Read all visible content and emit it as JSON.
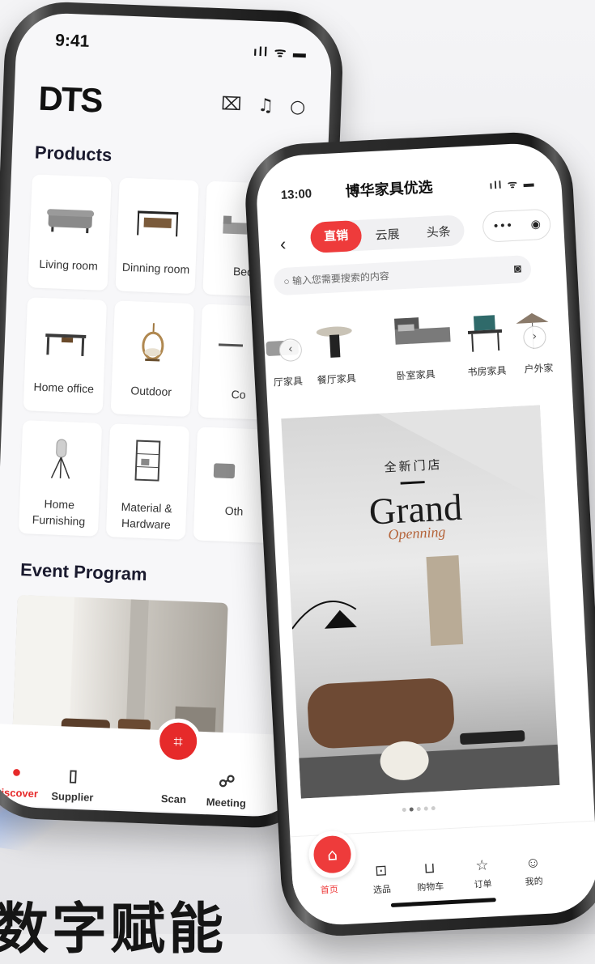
{
  "back_phone": {
    "status_time": "9:41",
    "status_icons": "ıll ᯤ ▬",
    "logo": "DTS",
    "products_heading": "Products",
    "categories": [
      {
        "label": "Living room"
      },
      {
        "label": "Dinning room"
      },
      {
        "label": "Bed"
      },
      {
        "label": "Home office"
      },
      {
        "label": "Outdoor"
      },
      {
        "label": "Co"
      },
      {
        "label": "Home Furnishing"
      },
      {
        "label": "Material & Hardware"
      },
      {
        "label": "Oth"
      }
    ],
    "event_heading": "Event Program",
    "tabs": [
      {
        "label": "Discover",
        "icon": "compass-icon"
      },
      {
        "label": "Supplier",
        "icon": "building-icon"
      },
      {
        "label": "Scan",
        "icon": "scan-icon"
      },
      {
        "label": "Meeting",
        "icon": "people-icon"
      }
    ]
  },
  "front_phone": {
    "status_time": "13:00",
    "status_icons": "ıll ᯤ ▬",
    "title": "博华家具优选",
    "segments": [
      "直销",
      "云展",
      "头条"
    ],
    "search_placeholder": "输入您需要搜索的内容",
    "categories": [
      {
        "label": "厅家具"
      },
      {
        "label": "餐厅家具"
      },
      {
        "label": "卧室家具"
      },
      {
        "label": "书房家具"
      },
      {
        "label": "户外家"
      }
    ],
    "banner": {
      "zh": "全新门店",
      "title": "Grand",
      "subtitle": "Openning"
    },
    "tabs": [
      {
        "label": "首页",
        "icon": "home-icon"
      },
      {
        "label": "选品",
        "icon": "select-icon"
      },
      {
        "label": "购物车",
        "icon": "cart-icon"
      },
      {
        "label": "订单",
        "icon": "order-icon"
      },
      {
        "label": "我的",
        "icon": "profile-icon"
      }
    ]
  },
  "headline": "数字赋能",
  "colors": {
    "accent": "#e62a2a",
    "dark": "#151515"
  }
}
